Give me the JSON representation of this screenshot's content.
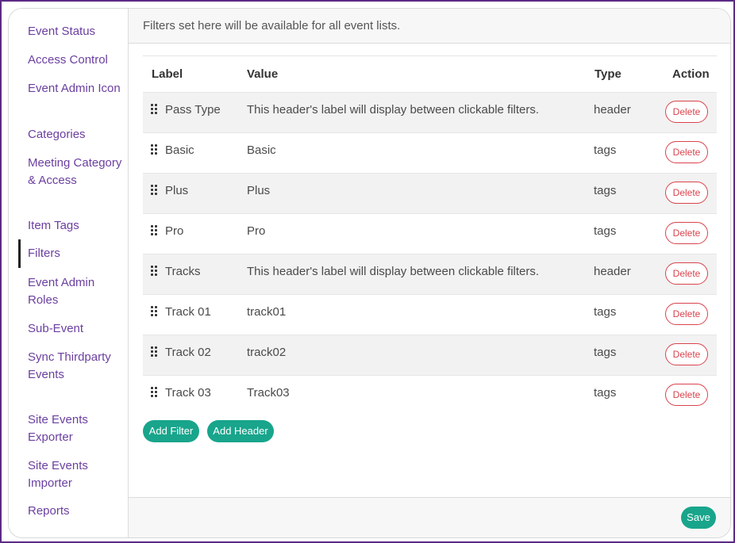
{
  "sidebar": {
    "items": [
      {
        "label": "Event Status"
      },
      {
        "label": "Access Control"
      },
      {
        "label": "Event Admin Icon"
      },
      {
        "label": "Categories"
      },
      {
        "label": "Meeting Category & Access"
      },
      {
        "label": "Item Tags"
      },
      {
        "label": "Filters",
        "active": true
      },
      {
        "label": "Event Admin Roles"
      },
      {
        "label": "Sub-Event"
      },
      {
        "label": "Sync Thirdparty Events"
      },
      {
        "label": "Site Events Exporter"
      },
      {
        "label": "Site Events Importer"
      },
      {
        "label": "Reports"
      }
    ]
  },
  "main": {
    "info_text": "Filters set here will be available for all event lists.",
    "table": {
      "columns": {
        "label": "Label",
        "value": "Value",
        "type": "Type",
        "action": "Action"
      },
      "rows": [
        {
          "label": "Pass Type",
          "value": "This header's label will display between clickable filters.",
          "type": "header",
          "action": "Delete"
        },
        {
          "label": "Basic",
          "value": "Basic",
          "type": "tags",
          "action": "Delete"
        },
        {
          "label": "Plus",
          "value": "Plus",
          "type": "tags",
          "action": "Delete"
        },
        {
          "label": "Pro",
          "value": "Pro",
          "type": "tags",
          "action": "Delete"
        },
        {
          "label": "Tracks",
          "value": "This header's label will display between clickable filters.",
          "type": "header",
          "action": "Delete"
        },
        {
          "label": "Track 01",
          "value": "track01",
          "type": "tags",
          "action": "Delete"
        },
        {
          "label": "Track 02",
          "value": "track02",
          "type": "tags",
          "action": "Delete"
        },
        {
          "label": "Track 03",
          "value": "Track03",
          "type": "tags",
          "action": "Delete"
        }
      ]
    },
    "add_filter_label": "Add Filter",
    "add_header_label": "Add Header",
    "save_label": "Save"
  },
  "colors": {
    "accent_green": "#18a58c",
    "nav_purple": "#6b3fa0",
    "delete_red": "#d9434d",
    "frame_purple": "#5b2a86"
  },
  "icons": {
    "row_handle": "drag-handle-icon"
  }
}
